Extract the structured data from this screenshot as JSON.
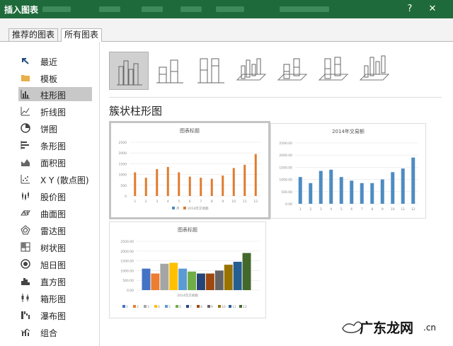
{
  "window": {
    "title": "插入图表",
    "help_label": "?",
    "close_label": "✕"
  },
  "tabs": [
    {
      "label": "推荐的图表"
    },
    {
      "label": "所有图表"
    }
  ],
  "nav": [
    {
      "label": "最近",
      "icon": "recent-icon"
    },
    {
      "label": "模板",
      "icon": "folder-icon"
    },
    {
      "label": "柱形图",
      "icon": "column-chart-icon",
      "selected": true
    },
    {
      "label": "折线图",
      "icon": "line-chart-icon"
    },
    {
      "label": "饼图",
      "icon": "pie-chart-icon"
    },
    {
      "label": "条形图",
      "icon": "bar-chart-icon"
    },
    {
      "label": "面积图",
      "icon": "area-chart-icon"
    },
    {
      "label": "X Y (散点图)",
      "icon": "scatter-chart-icon"
    },
    {
      "label": "股价图",
      "icon": "stock-chart-icon"
    },
    {
      "label": "曲面图",
      "icon": "surface-chart-icon"
    },
    {
      "label": "雷达图",
      "icon": "radar-chart-icon"
    },
    {
      "label": "树状图",
      "icon": "treemap-chart-icon"
    },
    {
      "label": "旭日图",
      "icon": "sunburst-chart-icon"
    },
    {
      "label": "直方图",
      "icon": "histogram-chart-icon"
    },
    {
      "label": "箱形图",
      "icon": "boxwhisker-chart-icon"
    },
    {
      "label": "瀑布图",
      "icon": "waterfall-chart-icon"
    },
    {
      "label": "组合",
      "icon": "combo-chart-icon"
    }
  ],
  "subtypes": [
    {
      "icon": "clustered-column-icon",
      "selected": true
    },
    {
      "icon": "stacked-column-icon"
    },
    {
      "icon": "100-stacked-column-icon"
    },
    {
      "icon": "3d-clustered-column-icon"
    },
    {
      "icon": "3d-stacked-column-icon"
    },
    {
      "icon": "3d-100-stacked-column-icon"
    },
    {
      "icon": "3d-column-icon"
    }
  ],
  "section_title": "簇状柱形图",
  "thumbs": [
    {
      "title": "图表标题"
    },
    {
      "title": "2014年交易额"
    },
    {
      "title": "图表标题"
    }
  ],
  "chart_data": [
    {
      "type": "bar",
      "title": "图表标题",
      "categories": [
        "1",
        "2",
        "3",
        "4",
        "5",
        "6",
        "7",
        "8",
        "9",
        "10",
        "11",
        "12"
      ],
      "series": [
        {
          "name": "月"
        },
        {
          "name": "2014年交易额",
          "values": [
            1100,
            850,
            1250,
            1350,
            1100,
            900,
            850,
            800,
            950,
            1300,
            1450,
            1950
          ]
        }
      ],
      "ylim": [
        0,
        2500
      ],
      "yticks": [
        "2500",
        "2000",
        "1500",
        "1000",
        "500",
        "0"
      ],
      "colors": [
        "#e07b2e"
      ],
      "legend": "bottom"
    },
    {
      "type": "bar",
      "title": "2014年交易额",
      "categories": [
        "1",
        "2",
        "3",
        "4",
        "5",
        "6",
        "7",
        "8",
        "9",
        "10",
        "11",
        "12"
      ],
      "series": [
        {
          "values": [
            1100,
            850,
            1350,
            1400,
            1100,
            950,
            850,
            850,
            1000,
            1300,
            1450,
            1900
          ]
        }
      ],
      "ylim": [
        0,
        2500
      ],
      "yticks": [
        "2500.00",
        "2000.00",
        "1500.00",
        "1000.00",
        "500.00",
        "0.00"
      ],
      "colors": [
        "#4e8cc2"
      ],
      "legend": "none"
    },
    {
      "type": "bar",
      "title": "图表标题",
      "categories": [
        ""
      ],
      "xlabel": "2014年交易额",
      "series": [
        {
          "name": "1",
          "values": [
            1100
          ]
        },
        {
          "name": "2",
          "values": [
            850
          ]
        },
        {
          "name": "3",
          "values": [
            1350
          ]
        },
        {
          "name": "4",
          "values": [
            1400
          ]
        },
        {
          "name": "5",
          "values": [
            1100
          ]
        },
        {
          "name": "6",
          "values": [
            950
          ]
        },
        {
          "name": "7",
          "values": [
            850
          ]
        },
        {
          "name": "8",
          "values": [
            850
          ]
        },
        {
          "name": "9",
          "values": [
            1000
          ]
        },
        {
          "name": "10",
          "values": [
            1300
          ]
        },
        {
          "name": "11",
          "values": [
            1450
          ]
        },
        {
          "name": "12",
          "values": [
            1900
          ]
        }
      ],
      "ylim": [
        0,
        2500
      ],
      "yticks": [
        "2500.00",
        "2000.00",
        "1500.00",
        "1000.00",
        "500.00",
        "0.00"
      ],
      "colors": [
        "#4472c4",
        "#ed7d31",
        "#a5a5a5",
        "#ffc000",
        "#5b9bd5",
        "#70ad47",
        "#264478",
        "#9e480e",
        "#636363",
        "#997300",
        "#255e91",
        "#43682b"
      ],
      "legend": "bottom"
    }
  ],
  "watermark": {
    "text": "广东龙网",
    "suffix": ".cn"
  }
}
